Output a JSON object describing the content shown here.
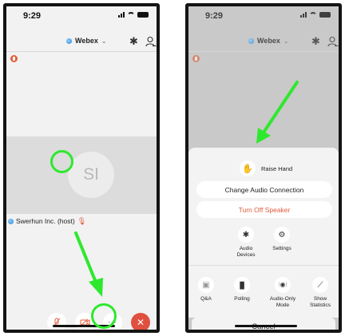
{
  "left": {
    "status_time": "9:29",
    "header": {
      "app_name": "Webex",
      "chevron": "⌄"
    },
    "avatar_initials": "SI",
    "participant_name": "Swerhun Inc. (host)",
    "controls": {
      "more_label": "···"
    }
  },
  "right": {
    "status_time": "9:29",
    "header": {
      "app_name": "Webex",
      "chevron": "⌄"
    },
    "sheet": {
      "raise_hand_label": "Raise Hand",
      "change_audio_label": "Change Audio Connection",
      "turn_off_speaker_label": "Turn Off Speaker",
      "options_row1": [
        {
          "label": "Audio\nDevices",
          "icon": "bluetooth-icon"
        },
        {
          "label": "Settings",
          "icon": "gear-icon"
        }
      ],
      "options_row2": [
        {
          "label": "Q&A",
          "icon": "qa-icon"
        },
        {
          "label": "Polling",
          "icon": "polling-icon"
        },
        {
          "label": "Audio-Only\nMode",
          "icon": "audio-only-icon"
        },
        {
          "label": "Show\nStatistics",
          "icon": "statistics-icon"
        }
      ],
      "cancel_label": "Cancel"
    }
  },
  "colors": {
    "highlight_green": "#2ee82e",
    "end_call_red": "#e0503f",
    "warning_text": "#e05a3a"
  }
}
